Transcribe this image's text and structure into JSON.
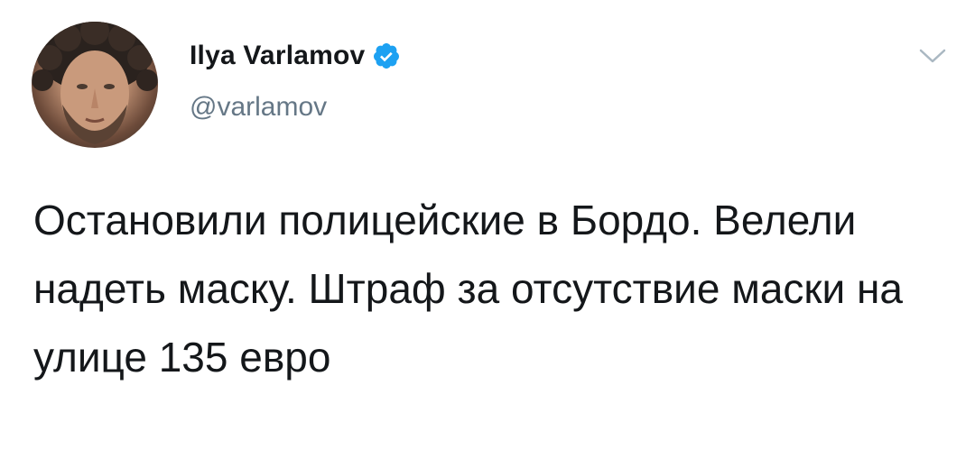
{
  "author": {
    "display_name": "Ilya Varlamov",
    "handle": "@varlamov",
    "verified": true,
    "avatar_icon": "user-photo-avatar"
  },
  "tweet": {
    "text": "Остановили полицейские в Бордо. Велели надеть маску. Штраф за отсутствие маски на улице 135 евро"
  },
  "colors": {
    "text": "#14171a",
    "secondary": "#657786",
    "verified_blue": "#1da1f2",
    "chevron": "#aab8c2"
  }
}
